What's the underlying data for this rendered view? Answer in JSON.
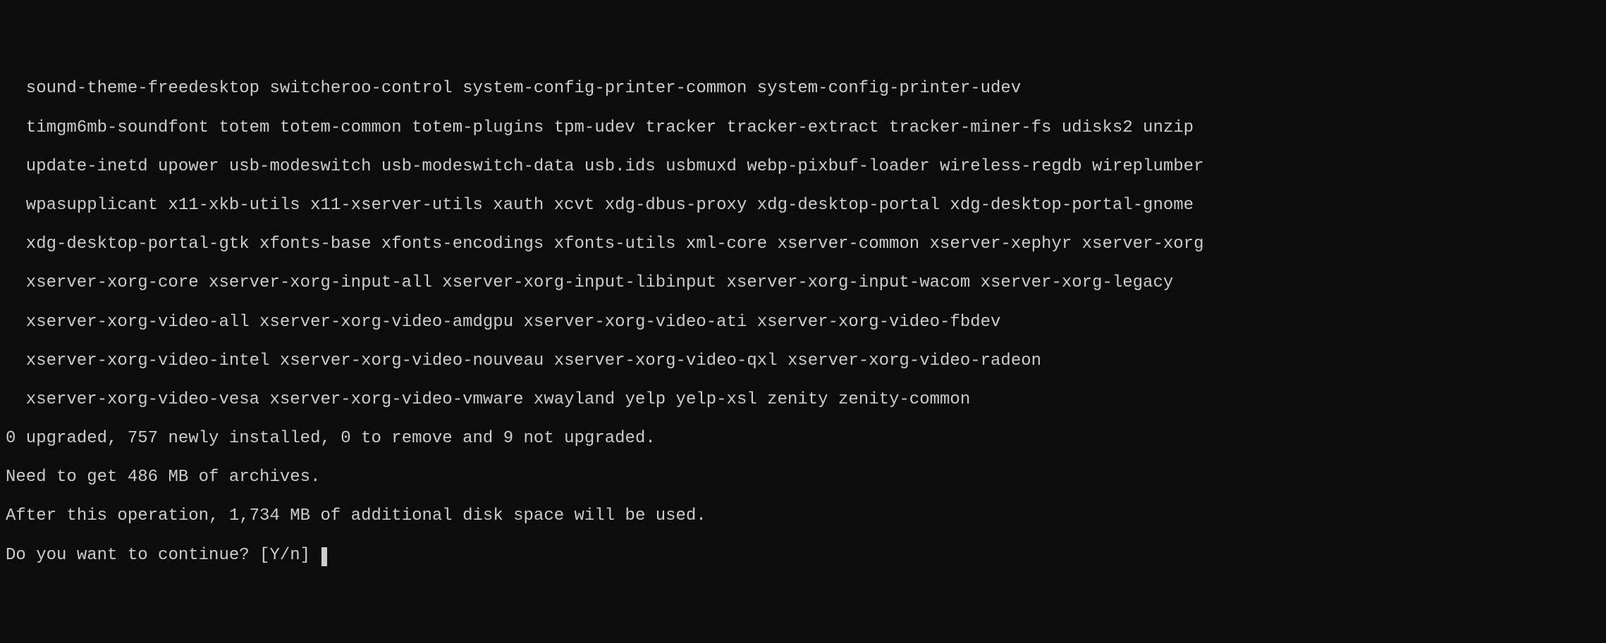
{
  "packages": {
    "line1": "sound-theme-freedesktop switcheroo-control system-config-printer-common system-config-printer-udev",
    "line2": "timgm6mb-soundfont totem totem-common totem-plugins tpm-udev tracker tracker-extract tracker-miner-fs udisks2 unzip",
    "line3": "update-inetd upower usb-modeswitch usb-modeswitch-data usb.ids usbmuxd webp-pixbuf-loader wireless-regdb wireplumber",
    "line4": "wpasupplicant x11-xkb-utils x11-xserver-utils xauth xcvt xdg-dbus-proxy xdg-desktop-portal xdg-desktop-portal-gnome",
    "line5": "xdg-desktop-portal-gtk xfonts-base xfonts-encodings xfonts-utils xml-core xserver-common xserver-xephyr xserver-xorg",
    "line6": "xserver-xorg-core xserver-xorg-input-all xserver-xorg-input-libinput xserver-xorg-input-wacom xserver-xorg-legacy",
    "line7": "xserver-xorg-video-all xserver-xorg-video-amdgpu xserver-xorg-video-ati xserver-xorg-video-fbdev",
    "line8": "xserver-xorg-video-intel xserver-xorg-video-nouveau xserver-xorg-video-qxl xserver-xorg-video-radeon",
    "line9": "xserver-xorg-video-vesa xserver-xorg-video-vmware xwayland yelp yelp-xsl zenity zenity-common"
  },
  "summary": {
    "upgrade_line": "0 upgraded, 757 newly installed, 0 to remove and 9 not upgraded.",
    "download_line": "Need to get 486 MB of archives.",
    "disk_line": "After this operation, 1,734 MB of additional disk space will be used."
  },
  "prompt": {
    "text": "Do you want to continue? [Y/n] "
  }
}
